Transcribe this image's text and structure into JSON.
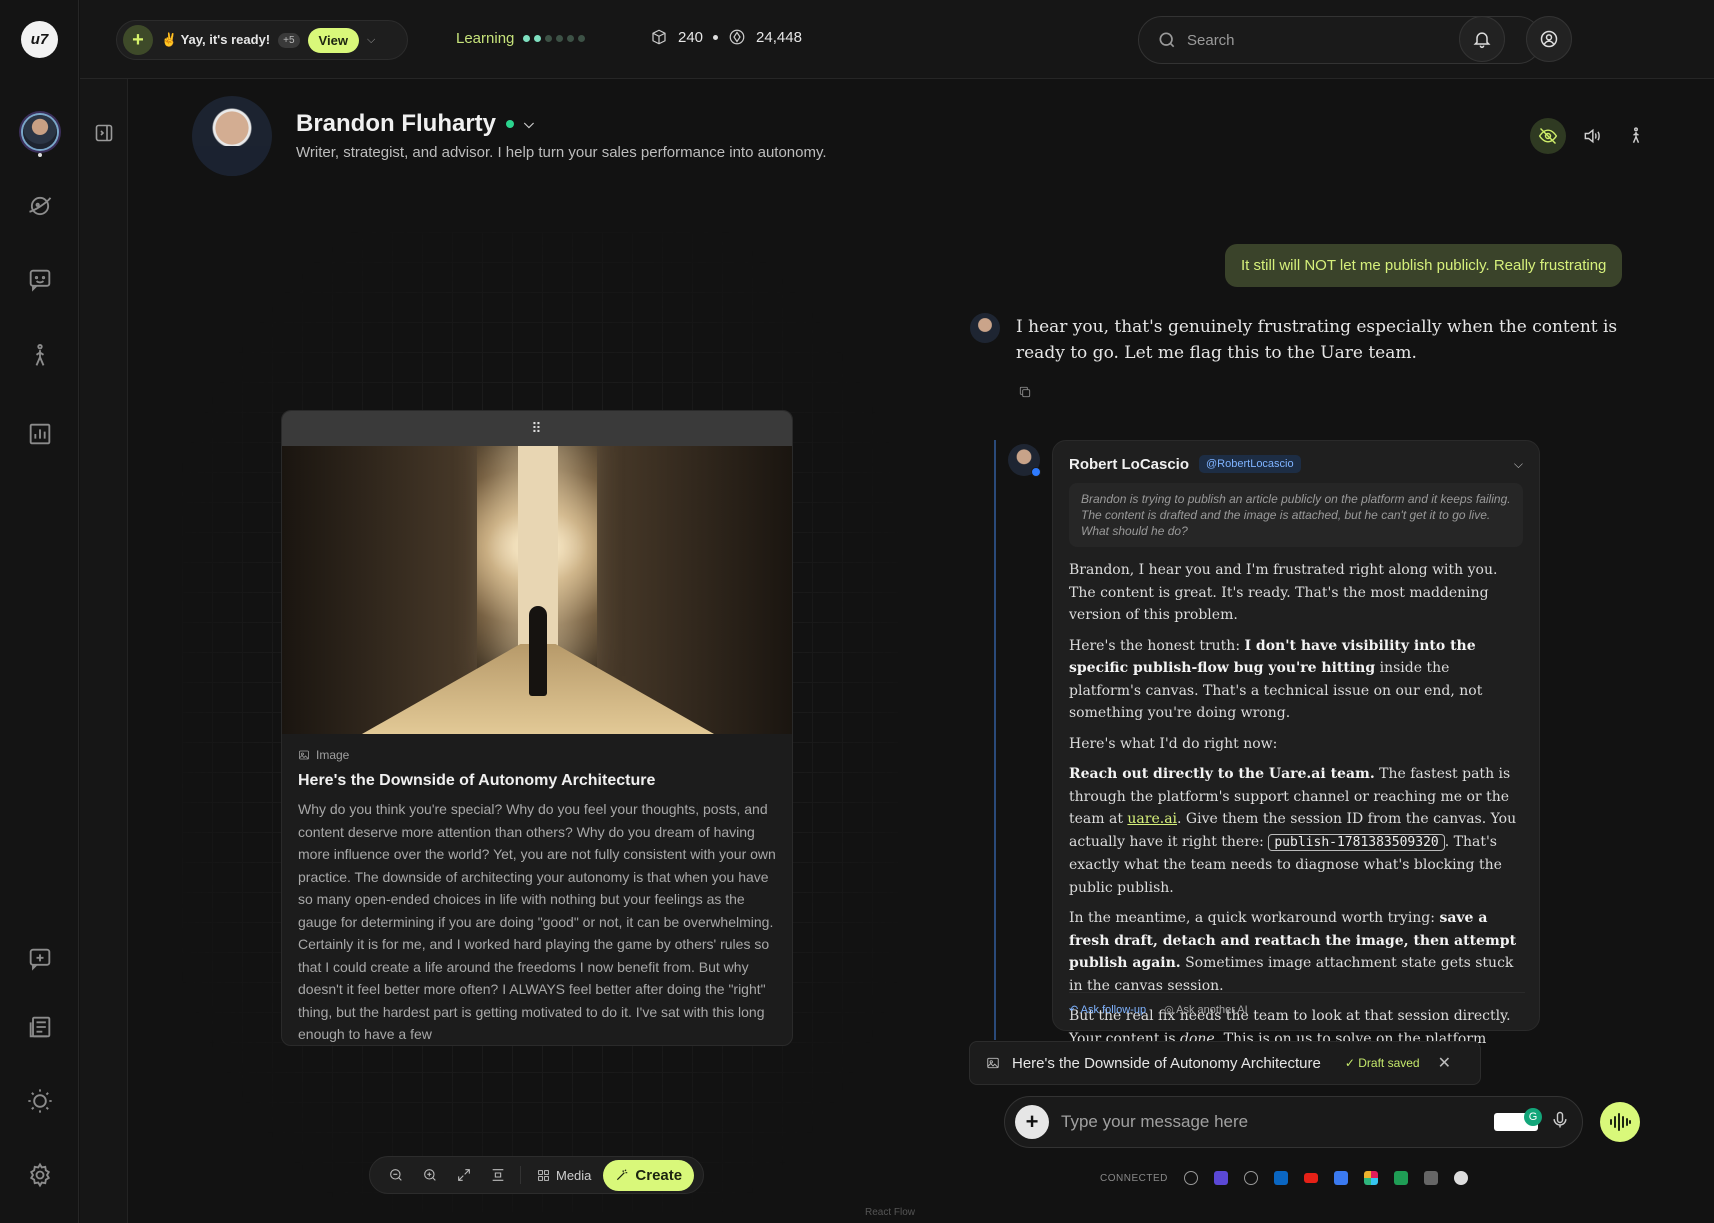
{
  "app": {
    "logo_text": "u7"
  },
  "topbar": {
    "notification_text": "✌️  Yay, it's ready!",
    "notification_count": "+5",
    "view_label": "View",
    "learning_label": "Learning",
    "learning_dots_total": 6,
    "learning_dots_filled": 2,
    "stat_one": "240",
    "stat_two": "24,448",
    "search_placeholder": "Search"
  },
  "profile": {
    "name": "Brandon Fluharty",
    "bio": "Writer, strategist, and advisor. I help turn your sales performance into autonomy."
  },
  "card": {
    "handle": "⠿",
    "label": "Image",
    "title": "Here's the Downside of Autonomy Architecture",
    "body": "Why do you think you're special? Why do you feel your thoughts, posts, and content deserve more attention than others? Why do you dream of having more influence over the world? Yet, you are not fully consistent with your own practice. The downside of architecting your autonomy is that when you have so many open-ended choices in life with nothing but your feelings as the gauge for determining if you are doing \"good\" or not, it can be overwhelming. Certainly it is for me, and I worked hard playing the game by others' rules so that I could create a life around the freedoms I now benefit from. But why doesn't it feel better more often? I ALWAYS feel better after doing the \"right\" thing, but the hardest part is getting motivated to do it. I've sat with this long enough to have a few"
  },
  "toolbar": {
    "media_label": "Media",
    "create_label": "Create"
  },
  "footer_brand": "React Flow",
  "chat": {
    "user_message": "It still will NOT let me publish publicly. Really frustrating",
    "assistant_message": "I hear you, that's genuinely frustrating especially when the content is ready to go. Let me flag this to the Uare team.",
    "thread": {
      "name": "Robert LoCascio",
      "handle": "@RobertLocascio",
      "quote": "Brandon is trying to publish an article publicly on the platform and it keeps failing. The content is drafted and the image is attached, but he can't get it to go live. What should he do?",
      "p1": "Brandon, I hear you and I'm frustrated right along with you. The content is great. It's ready. That's the most maddening version of this problem.",
      "p2_a": "Here's the honest truth: ",
      "p2_b": "I don't have visibility into the specific publish-flow bug you're hitting",
      "p2_c": " inside the platform's canvas. That's a technical issue on our end, not something you're doing wrong.",
      "p3": "Here's what I'd do right now:",
      "p4_a": "Reach out directly to the Uare.ai team.",
      "p4_b": " The fastest path is through the platform's support channel or reaching me or the team at ",
      "p4_link": "uare.ai",
      "p4_c": ". Give them the session ID from the canvas. You actually have it right there: ",
      "p4_code": "publish-1781383509320",
      "p4_d": ". That's exactly what the team needs to diagnose what's blocking the public publish.",
      "p5_a": "In the meantime, a quick workaround worth trying: ",
      "p5_b": "save a fresh draft, detach and reattach the image, then attempt publish again.",
      "p5_c": " Sometimes image attachment state gets stuck in the canvas session.",
      "p6_a": "But the real fix needs the team to look at that session directly. Your content is ",
      "p6_em": "done.",
      "p6_b": " This is on us to solve on the platform side.",
      "followup_label": "Ask follow-up",
      "ask_ai_label": "Ask another AI"
    },
    "draft": {
      "title": "Here's the Downside of Autonomy Architecture",
      "status": "Draft saved"
    },
    "composer_placeholder": "Type your message here",
    "connected_label": "CONNECTED"
  },
  "colors": {
    "accent": "#d9f87a",
    "background": "#121212",
    "online": "#2bd48e",
    "link_blue": "#7fb3ff"
  },
  "icons": [
    "search-icon",
    "bell-icon",
    "user-circle-icon",
    "panel-toggle-icon",
    "eye-off-icon",
    "speaker-icon",
    "walking-icon",
    "copy-icon",
    "image-icon",
    "zoom-out-icon",
    "zoom-in-icon",
    "expand-icon",
    "fit-icon",
    "grid-icon",
    "wand-icon",
    "microphone-icon",
    "waveform-icon"
  ]
}
